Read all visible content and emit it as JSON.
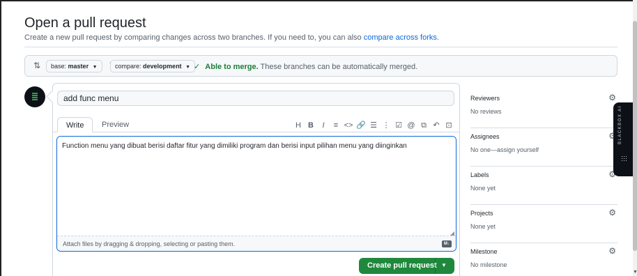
{
  "page": {
    "title": "Open a pull request",
    "subtitle_prefix": "Create a new pull request by comparing changes across two branches. If you need to, you can also ",
    "subtitle_link": "compare across forks",
    "subtitle_suffix": "."
  },
  "compare_bar": {
    "base_label": "base:",
    "base_branch": "master",
    "compare_label": "compare:",
    "compare_branch": "development",
    "merge_status": "Able to merge.",
    "merge_detail": "These branches can be automatically merged."
  },
  "composer": {
    "title_value": "add func menu",
    "tabs": [
      "Write",
      "Preview"
    ],
    "toolbar": [
      "H",
      "B",
      "I",
      "≡",
      "<>",
      "🔗",
      "☰",
      "⋮",
      "☑",
      "@",
      "⧉",
      "↶",
      "⊡"
    ],
    "body_value": "Function menu yang dibuat berisi daftar fitur yang dimiliki program dan berisi input pilihan menu yang diinginkan",
    "attach_hint": "Attach files by dragging & dropping, selecting or pasting them.",
    "md_badge": "M↓",
    "create_button": "Create pull request"
  },
  "sidebar": {
    "items": [
      {
        "title": "Reviewers",
        "value": "No reviews"
      },
      {
        "title": "Assignees",
        "value": "No one—assign yourself"
      },
      {
        "title": "Labels",
        "value": "None yet"
      },
      {
        "title": "Projects",
        "value": "None yet"
      },
      {
        "title": "Milestone",
        "value": "No milestone"
      }
    ]
  },
  "extension": {
    "label": "BLACKBOX AI"
  }
}
